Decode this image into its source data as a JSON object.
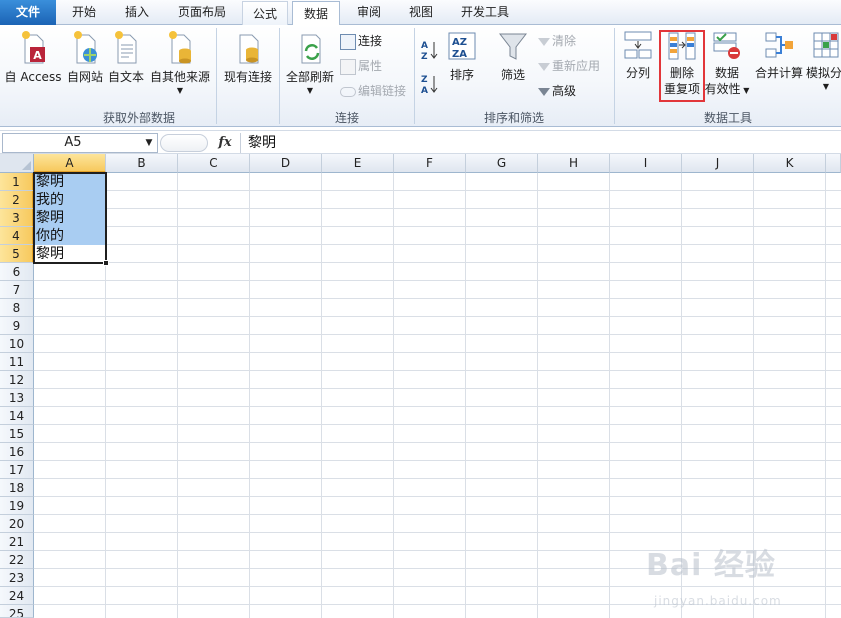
{
  "tabs": [
    {
      "key": "file",
      "label": "文件"
    },
    {
      "key": "home",
      "label": "开始"
    },
    {
      "key": "insert",
      "label": "插入"
    },
    {
      "key": "layout",
      "label": "页面布局"
    },
    {
      "key": "formulas",
      "label": "公式"
    },
    {
      "key": "data",
      "label": "数据"
    },
    {
      "key": "review",
      "label": "审阅"
    },
    {
      "key": "view",
      "label": "视图"
    },
    {
      "key": "developer",
      "label": "开发工具"
    }
  ],
  "ribbon": {
    "groups": {
      "external": "获取外部数据",
      "connections": "连接",
      "sort_filter": "排序和筛选",
      "data_tools": "数据工具"
    },
    "external": {
      "access": "自 Access",
      "web": "自网站",
      "text": "自文本",
      "other": "自其他来源",
      "existing": "现有连接"
    },
    "connections": {
      "refresh_all": "全部刷新",
      "connections": "连接",
      "properties": "属性",
      "edit_links": "编辑链接"
    },
    "sort_filter": {
      "sort": "排序",
      "filter": "筛选",
      "clear": "清除",
      "reapply": "重新应用",
      "advanced": "高级"
    },
    "data_tools": {
      "text_to_columns": "分列",
      "remove_dup_line1": "删除",
      "remove_dup_line2": "重复项",
      "validation_line1": "数据",
      "validation_line2": "有效性",
      "consolidate": "合并计算",
      "what_if": "模拟分"
    }
  },
  "formula_bar": {
    "name_box": "A5",
    "fx": "fx",
    "content": "黎明"
  },
  "columns": [
    "A",
    "B",
    "C",
    "D",
    "E",
    "F",
    "G",
    "H",
    "I",
    "J",
    "K"
  ],
  "rows": [
    "1",
    "2",
    "3",
    "4",
    "5",
    "6",
    "7",
    "8",
    "9",
    "10",
    "11",
    "12",
    "13",
    "14",
    "15",
    "16",
    "17",
    "18",
    "19",
    "20",
    "21",
    "22",
    "23",
    "24",
    "25"
  ],
  "cells": {
    "A1": "黎明",
    "A2": "我的",
    "A3": "黎明",
    "A4": "你的",
    "A5": "黎明"
  },
  "watermark": {
    "main": "Bai 经验",
    "sub": "jingyan.baidu.com"
  }
}
